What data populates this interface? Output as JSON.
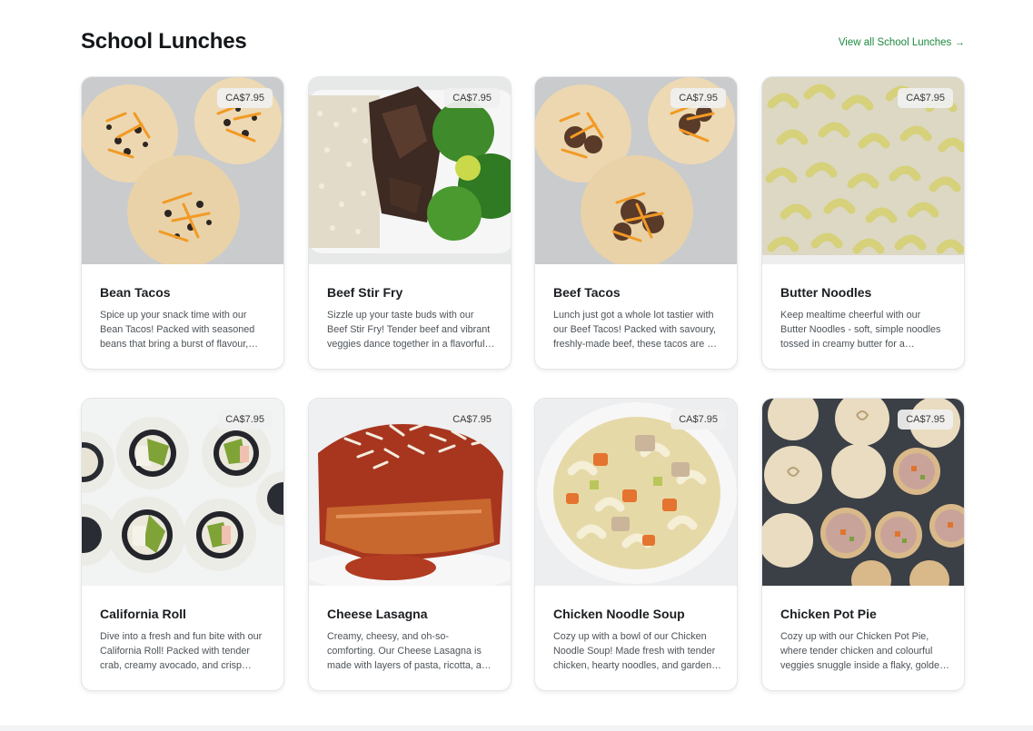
{
  "section": {
    "title": "School Lunches",
    "view_all": "View all School Lunches →"
  },
  "items": [
    {
      "name": "Bean Tacos",
      "price": "CA$7.95",
      "description": "Spice up your snack time with our Bean Tacos! Packed with seasoned beans that bring a burst of flavour, each bite is a little fiesta."
    },
    {
      "name": "Beef Stir Fry",
      "price": "CA$7.95",
      "description": "Sizzle up your taste buds with our Beef Stir Fry! Tender beef and vibrant veggies dance together in a flavorful sauce."
    },
    {
      "name": "Beef Tacos",
      "price": "CA$7.95",
      "description": "Lunch just got a whole lot tastier with our Beef Tacos! Packed with savoury, freshly-made beef, these tacos are a crowd favourite."
    },
    {
      "name": "Butter Noodles",
      "price": "CA$7.95",
      "description": "Keep mealtime cheerful with our Butter Noodles - soft, simple noodles tossed in creamy butter for a comforting classic."
    },
    {
      "name": "California Roll",
      "price": "CA$7.95",
      "description": "Dive into a fresh and fun bite with our California Roll! Packed with tender crab, creamy avocado, and crisp cucumber."
    },
    {
      "name": "Cheese Lasagna",
      "price": "CA$7.95",
      "description": "Creamy, cheesy, and oh-so-comforting. Our Cheese Lasagna is made with layers of pasta, ricotta, and rich tomato sauce."
    },
    {
      "name": "Chicken Noodle Soup",
      "price": "CA$7.95",
      "description": "Cozy up with a bowl of our Chicken Noodle Soup! Made fresh with tender chicken, hearty noodles, and garden vegetables."
    },
    {
      "name": "Chicken Pot Pie",
      "price": "CA$7.95",
      "description": "Cozy up with our Chicken Pot Pie, where tender chicken and colourful veggies snuggle inside a flaky, golden crust."
    }
  ],
  "colors": {
    "accent_link": "#1d8a3e",
    "title_text": "#14171a",
    "card_border": "#e3e5e8"
  }
}
